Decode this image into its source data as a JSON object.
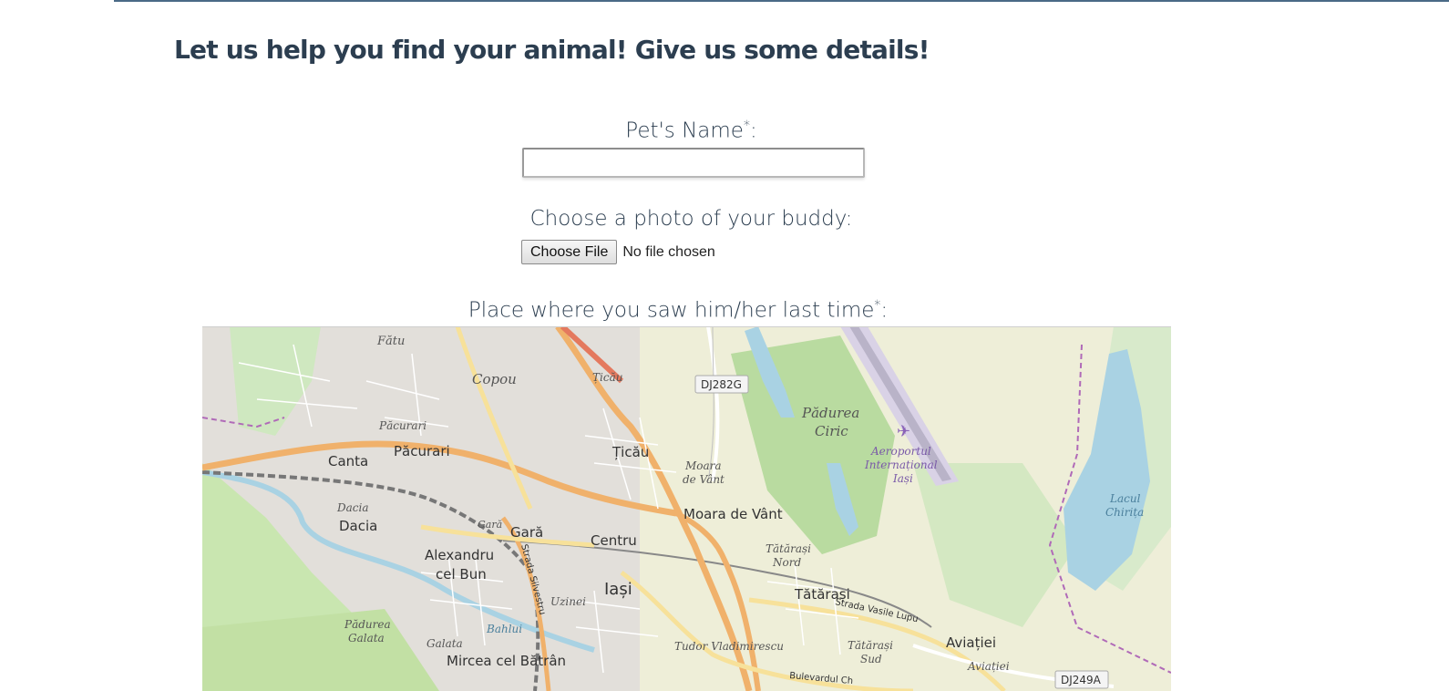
{
  "page": {
    "title": "Let us help you find your animal! Give us some details!"
  },
  "form": {
    "pet_name": {
      "label": "Pet's Name",
      "required_mark": "*",
      "suffix": ":",
      "value": ""
    },
    "photo": {
      "label": "Choose a photo of your buddy:",
      "button_label": "Choose File",
      "status": "No file chosen"
    },
    "place": {
      "label": "Place where you saw him/her last time",
      "required_mark": "*",
      "suffix": ":"
    }
  },
  "map": {
    "labels": {
      "fatu": "Fătu",
      "copou": "Copou",
      "ticau_top": "Țicău",
      "dj282g": "DJ282G",
      "padurea_ciric_1": "Pădurea",
      "padurea_ciric_2": "Ciric",
      "pacurari_small": "Păcurari",
      "pacurari": "Păcurari",
      "canta": "Canta",
      "ticau": "Țicău",
      "aeroport_1": "Aeroportul",
      "aeroport_2": "Internațional",
      "aeroport_3": "Iași",
      "moara_small_1": "Moara",
      "moara_small_2": "de Vânt",
      "lacul_1": "Lacul",
      "lacul_2": "Chirița",
      "dacia_small": "Dacia",
      "dacia": "Dacia",
      "gara_small": "Gară",
      "gara": "Gară",
      "moara": "Moara de Vânt",
      "centru": "Centru",
      "alexandru_1": "Alexandru",
      "alexandru_2": "cel Bun",
      "tatarasi_nord_1": "Tătărași",
      "tatarasi_nord_2": "Nord",
      "iasi": "Iași",
      "tatarasi": "Tătărași",
      "strada_silvestru": "Strada Silvestru",
      "uzinei": "Uzinei",
      "strada_vasile_lupu": "Strada Vasile Lupu",
      "padurea_galata_1": "Pădurea",
      "padurea_galata_2": "Galata",
      "bahlui": "Bahlui",
      "galata": "Galata",
      "tudor": "Tudor Vladimirescu",
      "tatarasi_sud_1": "Tătărași",
      "tatarasi_sud_2": "Sud",
      "aviatiei": "Aviației",
      "aviatiei_small": "Aviației",
      "mircea": "Mircea cel Bătrân",
      "bulevardul": "Bulevardul Ch",
      "dj249a": "DJ249A"
    }
  }
}
